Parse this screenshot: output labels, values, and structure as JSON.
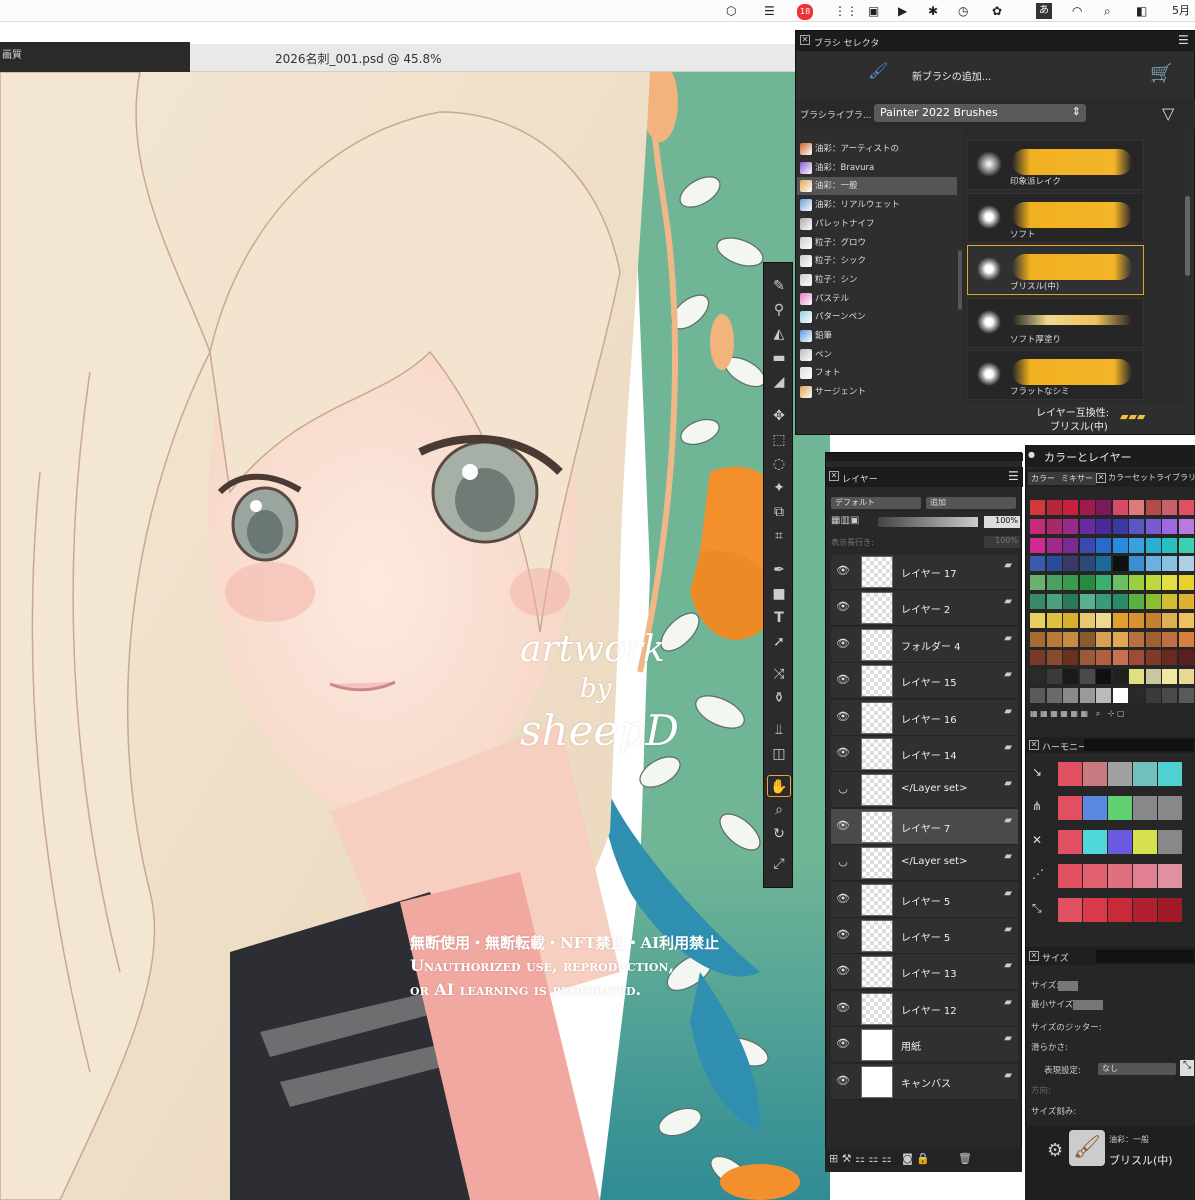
{
  "menubar": {
    "badge": "18",
    "ime": "あ",
    "clock": "5月"
  },
  "left_panel": {
    "label": "画質"
  },
  "document": {
    "title": "2026名刺_001.psd @ 45.8%"
  },
  "watermark": {
    "line1": "artwork",
    "line2": "by",
    "line3": "sheepD",
    "notice_ja": "無断使用・無断転載・NFT禁止・AI利用禁止",
    "notice_en1": "Unauthorized use, reproduction,",
    "notice_en2": "or AI learning is prohibited."
  },
  "brush_selector": {
    "title": "ブラシ セレクタ",
    "new_brush": "新ブラシの追加...",
    "library_label": "ブラシライブラ...",
    "library_value": "Painter 2022 Brushes",
    "categories": [
      {
        "label": "油彩：アーティストの",
        "color": "#c9632a"
      },
      {
        "label": "油彩：Bravura",
        "color": "#8a5cd6"
      },
      {
        "label": "油彩：一般",
        "color": "#e0a850"
      },
      {
        "label": "油彩：リアルウェット",
        "color": "#6f9ad8"
      },
      {
        "label": "パレットナイフ",
        "color": "#aaaaaa"
      },
      {
        "label": "粒子：グロウ",
        "color": "#cccccc"
      },
      {
        "label": "粒子：シック",
        "color": "#cccccc"
      },
      {
        "label": "粒子：シン",
        "color": "#cccccc"
      },
      {
        "label": "パステル",
        "color": "#e07ac0"
      },
      {
        "label": "パターンペン",
        "color": "#8fd0e0"
      },
      {
        "label": "鉛筆",
        "color": "#5a9ae0"
      },
      {
        "label": "ペン",
        "color": "#bbbbbb"
      },
      {
        "label": "フォト",
        "color": "#dddddd"
      },
      {
        "label": "サージェント",
        "color": "#e0a050"
      }
    ],
    "variants": [
      {
        "label": "印象派レイク"
      },
      {
        "label": "ソフト"
      },
      {
        "label": "ブリスル(中)"
      },
      {
        "label": "ソフト厚塗り"
      },
      {
        "label": "フラットなシミ"
      }
    ],
    "compat_label": "レイヤー互換性:",
    "compat_value": "ブリスル(中)"
  },
  "layers_panel": {
    "title": "レイヤー",
    "composite_method": "デフォルト",
    "composite_depth": "追加",
    "opacity": "100%",
    "display_label": "表示長行き:",
    "display_value": "100%",
    "layers": [
      {
        "name": "レイヤー 17",
        "eye": "👁",
        "solid": false
      },
      {
        "name": "レイヤー 2",
        "eye": "👁",
        "solid": false
      },
      {
        "name": "フォルダー 4",
        "eye": "👁",
        "solid": false
      },
      {
        "name": "レイヤー 15",
        "eye": "👁",
        "solid": false
      },
      {
        "name": "レイヤー 16",
        "eye": "👁",
        "solid": false
      },
      {
        "name": "レイヤー 14",
        "eye": "👁",
        "solid": false
      },
      {
        "name": "</Layer set>",
        "eye": "◡",
        "solid": false
      },
      {
        "name": "レイヤー 7",
        "eye": "👁",
        "solid": false
      },
      {
        "name": "</Layer set>",
        "eye": "◡",
        "solid": false
      },
      {
        "name": "レイヤー 5",
        "eye": "👁",
        "solid": false
      },
      {
        "name": "レイヤー 5",
        "eye": "👁",
        "solid": false
      },
      {
        "name": "レイヤー 13",
        "eye": "👁",
        "solid": false
      },
      {
        "name": "レイヤー 12",
        "eye": "👁",
        "solid": false
      },
      {
        "name": "用紙",
        "eye": "👁",
        "solid": true
      },
      {
        "name": "キャンバス",
        "eye": "👁",
        "solid": true
      }
    ]
  },
  "color_layers": {
    "title": "カラーとレイヤー",
    "tabs": [
      "カラー",
      "ミキサー",
      "カラーセットライブラリ"
    ],
    "swatch_rows": [
      [
        "#d23a3a",
        "#b8263a",
        "#c8203e",
        "#a01a4a",
        "#7a1a5a",
        "#d84a6a",
        "#e07a7a",
        "#b44a4a",
        "#c8606e",
        "#e05060"
      ],
      [
        "#c82a7a",
        "#a8286a",
        "#9a2a8a",
        "#6a2aa0",
        "#4a2a9a",
        "#3a3aa0",
        "#5a58c0",
        "#7a5ad0",
        "#9a6ae0",
        "#b87ae0"
      ],
      [
        "#d02a90",
        "#a02a8a",
        "#7a2a90",
        "#3a4ab0",
        "#2a6ad0",
        "#2a8ae0",
        "#3aa0e0",
        "#2ab0d0",
        "#2ac0c0",
        "#3ad0b0"
      ],
      [
        "#3a5ab0",
        "#2a4a9a",
        "#3a3a6a",
        "#2a4a7a",
        "#1a6a9a",
        "#101010",
        "#3a90d0",
        "#6ab0e0",
        "#8ac0e0",
        "#aad0e8"
      ],
      [
        "#6ab070",
        "#4aa060",
        "#3a9a50",
        "#2a8a40",
        "#3ab070",
        "#6ac060",
        "#9ad040",
        "#c0d840",
        "#e0e040",
        "#e8d030"
      ],
      [
        "#3a8a6a",
        "#4aa080",
        "#2a7a5a",
        "#5ab090",
        "#3a9a7a",
        "#2a8a6a",
        "#5ab040",
        "#8ac030",
        "#d0c030",
        "#e0b030"
      ],
      [
        "#e8d060",
        "#e0c040",
        "#d8b030",
        "#e8c870",
        "#f0d890",
        "#e0a030",
        "#d89030",
        "#c88030",
        "#e0b050",
        "#f0c060"
      ],
      [
        "#a86a30",
        "#b87a3a",
        "#c88a40",
        "#8a5a2a",
        "#d8a050",
        "#e0a850",
        "#b87040",
        "#a06030",
        "#c07040",
        "#d88040"
      ],
      [
        "#7a3a2a",
        "#8a4a30",
        "#6a3020",
        "#9a5a3a",
        "#b06040",
        "#c87050",
        "#a04a3a",
        "#803a2a",
        "#6a2a20",
        "#5a2020"
      ],
      [
        "#2a2a2a",
        "#3a3a3a",
        "#1a1a1a",
        "#4a4a4a",
        "#101010",
        "#202020",
        "#e0e080",
        "#c8c8a0",
        "#f0e8a0",
        "#e8d890"
      ],
      [
        "#5a5a5a",
        "#6a6a6a",
        "#8a8a8a",
        "#9a9a9a",
        "#bababa",
        "#ffffff",
        "#2a2a2a",
        "#3a3a3a",
        "#4a4a4a",
        "#5a5a5a"
      ]
    ],
    "harmony_title": "ハーモニー",
    "harmony_rows": [
      [
        "#e05060",
        "#c87a80",
        "#a0a0a0",
        "#70c0c0",
        "#50d0d0"
      ],
      [
        "#e05060",
        "#5a8ae0",
        "#60d070",
        "#888888",
        "#888888"
      ],
      [
        "#e05060",
        "#50d8d8",
        "#6a5ae0",
        "#d8e050",
        "#888888"
      ],
      [
        "#e05060",
        "#e06070",
        "#e07080",
        "#e08090",
        "#e090a0"
      ],
      [
        "#e05060",
        "#d83a4a",
        "#c82a3a",
        "#b02030",
        "#a01a28"
      ]
    ]
  },
  "size_panel": {
    "title": "サイズ",
    "size": "サイズ:",
    "min_size": "最小サイズ:",
    "jitter": "サイズのジッター:",
    "smoothness": "滑らかさ:",
    "expression_label": "表現設定:",
    "expression_value": "なし",
    "direction": "方向:",
    "step": "サイズ刻み:"
  },
  "current_brush": {
    "category": "油彩：一般",
    "variant": "ブリスル(中)"
  }
}
